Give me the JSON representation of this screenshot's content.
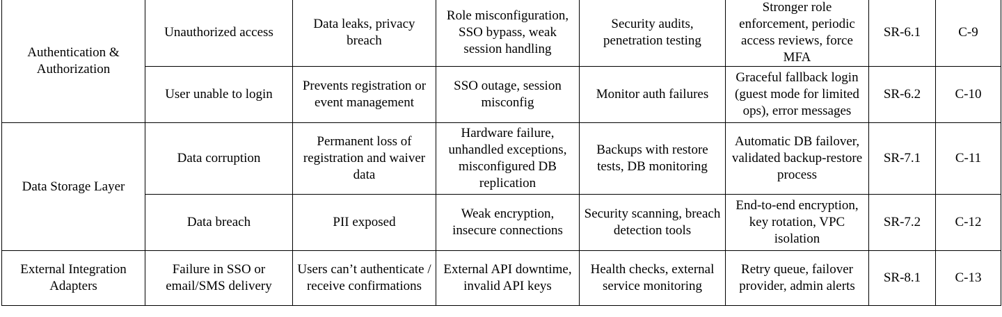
{
  "table": {
    "groups": [
      {
        "component": "Authentication & Authorization",
        "rows": [
          {
            "failure_mode": "Unauthorized access",
            "effect": "Data leaks, privacy breach",
            "cause": "Role misconfiguration, SSO bypass, weak session handling",
            "detection": "Security audits, penetration testing",
            "mitigation": "Stronger role enforcement, periodic access reviews, force MFA",
            "requirement": "SR-6.1",
            "control": "C-9"
          },
          {
            "failure_mode": "User unable to login",
            "effect": "Prevents registration or event management",
            "cause": "SSO outage, session misconfig",
            "detection": "Monitor auth failures",
            "mitigation": "Graceful fallback login (guest mode for limited ops), error messages",
            "requirement": "SR-6.2",
            "control": "C-10"
          }
        ]
      },
      {
        "component": "Data Storage Layer",
        "rows": [
          {
            "failure_mode": "Data corruption",
            "effect": "Permanent loss of registration and waiver data",
            "cause": "Hardware failure, unhandled exceptions, misconfigured DB replication",
            "detection": "Backups with restore tests, DB monitoring",
            "mitigation": "Automatic DB failover, validated backup-restore process",
            "requirement": "SR-7.1",
            "control": "C-11"
          },
          {
            "failure_mode": "Data breach",
            "effect": "PII exposed",
            "cause": "Weak encryption, insecure connections",
            "detection": "Security scanning, breach detection tools",
            "mitigation": "End-to-end encryption, key rotation, VPC isolation",
            "requirement": "SR-7.2",
            "control": "C-12"
          }
        ]
      },
      {
        "component": "External Integration Adapters",
        "rows": [
          {
            "failure_mode": "Failure in SSO or email/SMS delivery",
            "effect": "Users can’t authenticate / receive confirmations",
            "cause": "External API downtime, invalid API keys",
            "detection": "Health checks, external service monitoring",
            "mitigation": "Retry queue, failover provider, admin alerts",
            "requirement": "SR-8.1",
            "control": "C-13"
          }
        ]
      }
    ]
  }
}
